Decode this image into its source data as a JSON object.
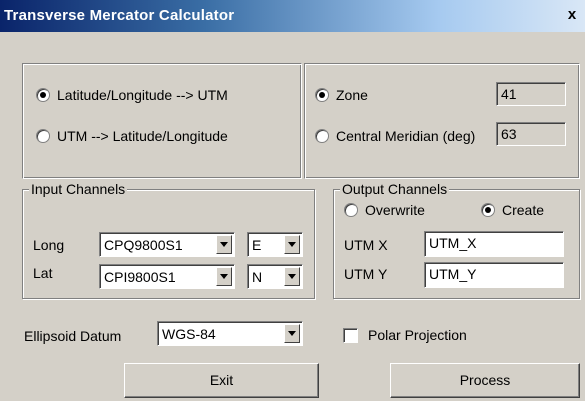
{
  "window": {
    "title": "Transverse Mercator Calculator",
    "close_label": "x"
  },
  "mode": {
    "options": [
      {
        "label": "Latitude/Longitude --> UTM",
        "checked": true
      },
      {
        "label": "UTM --> Latitude/Longitude",
        "checked": false
      }
    ]
  },
  "zone_panel": {
    "zone_label": "Zone",
    "zone_value": "41",
    "zone_checked": true,
    "meridian_label": "Central Meridian (deg)",
    "meridian_value": "63",
    "meridian_checked": false
  },
  "input_channels": {
    "legend": "Input Channels",
    "long_label": "Long",
    "long_channel": "CPQ9800S1",
    "long_dir": "E",
    "lat_label": "Lat",
    "lat_channel": "CPI9800S1",
    "lat_dir": "N"
  },
  "output_channels": {
    "legend": "Output Channels",
    "overwrite_label": "Overwrite",
    "overwrite_checked": false,
    "create_label": "Create",
    "create_checked": true,
    "utmx_label": "UTM X",
    "utmx_value": "UTM_X",
    "utmy_label": "UTM Y",
    "utmy_value": "UTM_Y"
  },
  "ellipsoid": {
    "label": "Ellipsoid Datum",
    "value": "WGS-84"
  },
  "polar": {
    "label": "Polar Projection",
    "checked": false
  },
  "buttons": {
    "exit": "Exit",
    "process": "Process"
  },
  "icons": {
    "close": "close-icon",
    "dropdown": "chevron-down-icon"
  }
}
